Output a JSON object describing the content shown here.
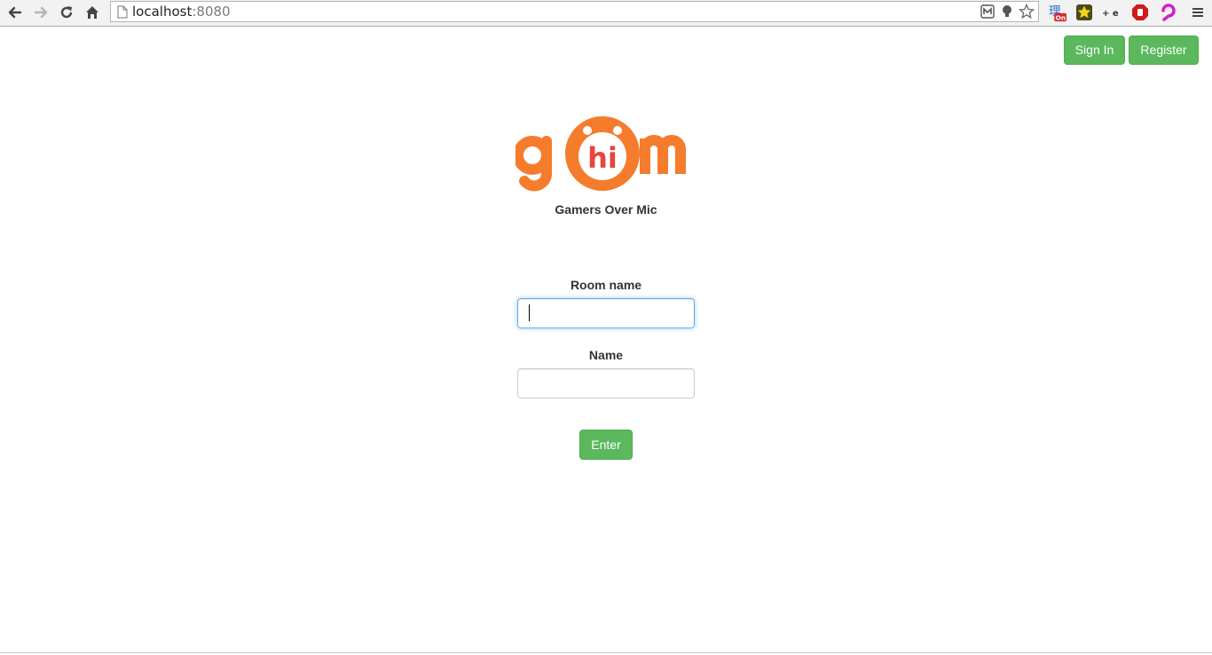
{
  "browser": {
    "url_host": "localhost",
    "url_port": ":8080",
    "extensions": {
      "translate_badge": "理",
      "translate_badge_status": "On",
      "tool_text": "+ e"
    }
  },
  "header": {
    "sign_in_label": "Sign In",
    "register_label": "Register"
  },
  "logo": {
    "wordmark": "gom",
    "bubble_text": "hi",
    "brand_color": "#f47c2c",
    "bubble_text_color": "#e8453c"
  },
  "tagline": "Gamers Over Mic",
  "form": {
    "room_label": "Room name",
    "room_value": "",
    "name_label": "Name",
    "name_value": "",
    "enter_label": "Enter"
  },
  "colors": {
    "button_green": "#5cb85c",
    "focus_blue": "#66afe9"
  }
}
